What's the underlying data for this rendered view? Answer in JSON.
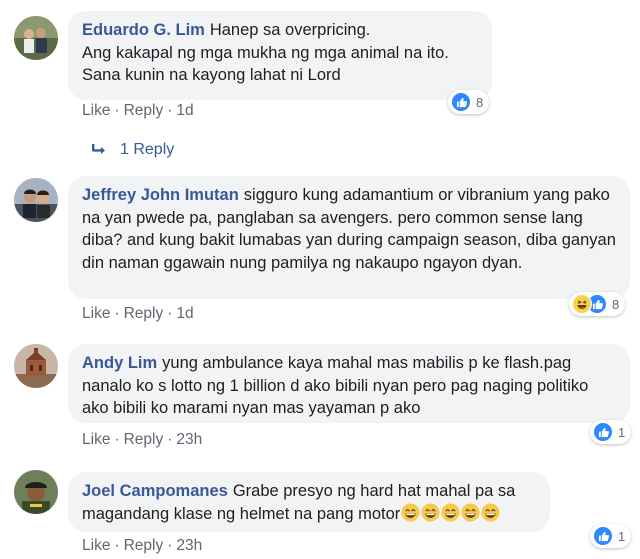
{
  "comments": [
    {
      "author": "Eduardo G. Lim",
      "text_lines": [
        "Hanep sa overpricing.",
        "Ang kakapal ng mga mukha ng mga animal na ito.",
        "Sana kunin na kayong lahat ni Lord"
      ],
      "reaction_count": "8",
      "reactions": [
        "like-icon"
      ],
      "like_label": "Like",
      "reply_label": "Reply",
      "time": "1d",
      "replies_label": "1 Reply"
    },
    {
      "author": "Jeffrey John Imutan",
      "text": "sigguro kung adamantium or vibranium yang pako na yan pwede pa, panglaban sa avengers. pero common sense lang diba? and kung bakit lumabas yan during campaign season, diba ganyan din naman ggawain nung pamilya ng nakaupo ngayon dyan.",
      "reaction_count": "8",
      "reactions": [
        "haha-icon",
        "like-icon"
      ],
      "like_label": "Like",
      "reply_label": "Reply",
      "time": "1d"
    },
    {
      "author": "Andy Lim",
      "text": "yung ambulance kaya mahal mas mabilis p ke flash.pag nanalo ko s lotto ng 1 billion d ako bibili nyan pero pag naging politiko ako bibili ko marami nyan mas yayaman p ako",
      "reaction_count": "1",
      "reactions": [
        "like-icon"
      ],
      "like_label": "Like",
      "reply_label": "Reply",
      "time": "23h"
    },
    {
      "author": "Joel Campomanes",
      "text": "Grabe presyo ng hard hat mahal pa sa magandang klase ng helmet na pang motor",
      "emoji_count": 5,
      "emoji_icon": "grinning-face-icon",
      "reaction_count": "1",
      "reactions": [
        "like-icon"
      ],
      "like_label": "Like",
      "reply_label": "Reply",
      "time": "23h"
    }
  ],
  "colors": {
    "author": "#385898",
    "bubble": "#f2f3f5",
    "meta": "#606770",
    "like_blue": "#2d88ff"
  }
}
